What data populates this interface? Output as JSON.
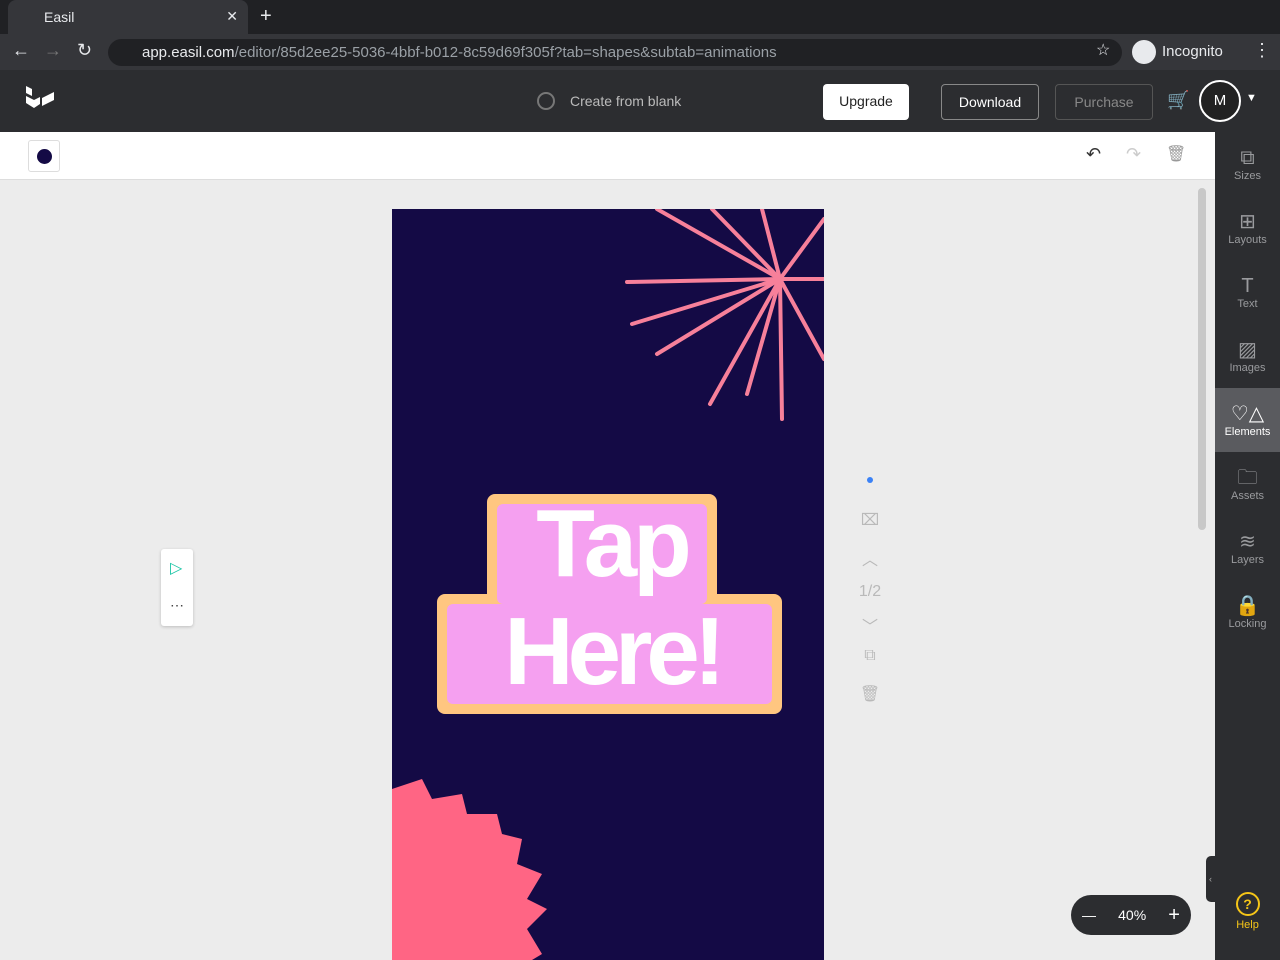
{
  "browser": {
    "tab_title": "Easil",
    "url_host": "app.easil.com",
    "url_path": "/editor/85d2ee25-5036-4bbf-b012-8c59d69f305f?tab=shapes&subtab=animations",
    "profile": "Incognito"
  },
  "header": {
    "status": "Create from blank",
    "upgrade": "Upgrade",
    "download": "Download",
    "purchase": "Purchase",
    "avatar": "M"
  },
  "toolbar": {
    "color": "#140a45"
  },
  "canvas": {
    "line1": "Tap",
    "line2": "Here!"
  },
  "pages": {
    "indicator": "1/2"
  },
  "sidebar": {
    "items": [
      {
        "label": "Sizes",
        "icon": "sizes-icon"
      },
      {
        "label": "Layouts",
        "icon": "layouts-icon"
      },
      {
        "label": "Text",
        "icon": "text-icon"
      },
      {
        "label": "Images",
        "icon": "images-icon"
      },
      {
        "label": "Elements",
        "icon": "elements-icon"
      },
      {
        "label": "Assets",
        "icon": "assets-icon"
      },
      {
        "label": "Layers",
        "icon": "layers-icon"
      },
      {
        "label": "Locking",
        "icon": "lock-icon"
      }
    ],
    "help": "Help"
  },
  "zoom": {
    "level": "40%"
  }
}
